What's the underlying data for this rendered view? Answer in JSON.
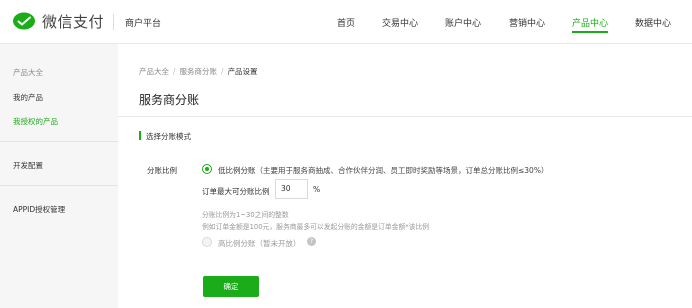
{
  "header": {
    "brand": "微信支付",
    "platform": "商户平台",
    "nav": [
      {
        "label": "首页"
      },
      {
        "label": "交易中心"
      },
      {
        "label": "账户中心"
      },
      {
        "label": "营销中心"
      },
      {
        "label": "产品中心"
      },
      {
        "label": "数据中心"
      }
    ],
    "active_nav": "产品中心"
  },
  "sidebar": {
    "group": "产品大全",
    "items": [
      {
        "label": "我的产品"
      },
      {
        "label": "我授权的产品"
      },
      {
        "label": "开发配置"
      },
      {
        "label": "APPID授权管理"
      }
    ],
    "active_item": "我授权的产品"
  },
  "breadcrumb": [
    "产品大全",
    "服务商分账",
    "产品设置"
  ],
  "page_title": "服务商分账",
  "section_title": "选择分账模式",
  "form": {
    "field_label": "分账比例",
    "options": [
      {
        "label": "低比例分账",
        "desc": "（主要用于服务商抽成、合作伙伴分润、员工即时奖励等场景，订单总分账比例≤30%）",
        "selected": true
      },
      {
        "label": "高比例分账（暂未开放）",
        "selected": false,
        "disabled": true
      }
    ],
    "max_ratio_label": "订单最大可分账比例",
    "max_ratio_value": "30",
    "unit": "%",
    "hint_line1": "分账比例为1~30之间的整数",
    "hint_line2": "例如订单金额是100元，服务商最多可以发起分账的金额是订单金额*该比例",
    "help_icon": "question-circle-icon",
    "confirm_label": "确定"
  },
  "colors": {
    "accent": "#1aad19"
  }
}
